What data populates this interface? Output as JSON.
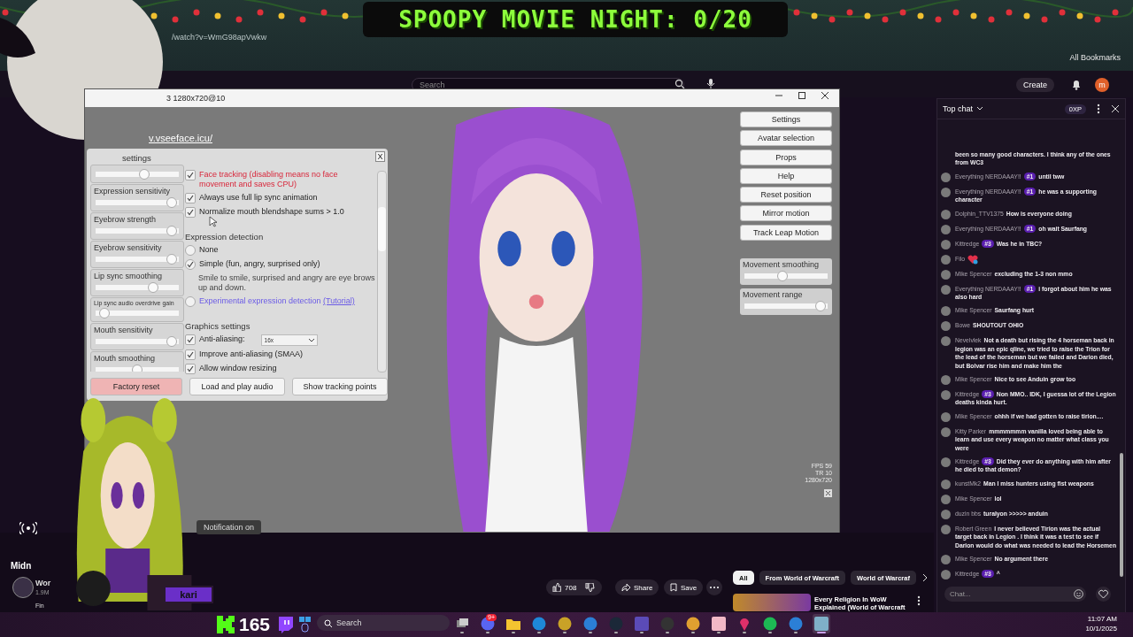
{
  "banner": {
    "title": "SPOOPY MOVIE NIGHT: 0/20"
  },
  "browser": {
    "url": "/watch?v=WmG98apVwkw",
    "bookmarks": "All Bookmarks"
  },
  "youtube": {
    "search_placeholder": "Search",
    "create": "Create",
    "account_initial": "m",
    "notification": "Notification on",
    "channel_title": "Midn",
    "channel_name": "Wor",
    "subscribers": "1.9M",
    "footer_text": "Fin",
    "likes": "708",
    "actions": [
      "Share",
      "Save"
    ],
    "chips": [
      {
        "label": "All",
        "selected": true
      },
      {
        "label": "From World of Warcraft",
        "selected": false
      },
      {
        "label": "World of Warcraf",
        "selected": false
      }
    ],
    "video_title": [
      "Every Religion In WoW",
      "Explained (World of Warcraft"
    ]
  },
  "vseeface": {
    "title": "3 1280x720@10",
    "url": "v.vseeface.icu/",
    "settings": {
      "title": "settings",
      "close": "X",
      "sliders": [
        {
          "level": 0.6
        },
        {
          "label": "Expression sensitivity",
          "level": 0.97
        },
        {
          "label": "Eyebrow strength",
          "level": 0.97
        },
        {
          "label": "Eyebrow sensitivity",
          "level": 0.97
        },
        {
          "label": "Lip  sync smoothing",
          "level": 0.72
        },
        {
          "label": "Lip sync audio overdrive gain",
          "level": 0.05,
          "small": true
        },
        {
          "label": "Mouth sensitivity",
          "level": 0.97
        },
        {
          "label": "Mouth smoothing",
          "level": 0.5
        }
      ],
      "options": [
        {
          "kind": "checkbox",
          "label": "Face tracking (disabling means no face movement and saves CPU)",
          "checked": true,
          "warning": true
        },
        {
          "kind": "checkbox",
          "label": "Always use full lip sync animation",
          "checked": true
        },
        {
          "kind": "checkbox",
          "label": "Normalize mouth blendshape sums > 1.0",
          "checked": true
        },
        {
          "kind": "heading",
          "label": "Expression detection"
        },
        {
          "kind": "radio",
          "label": "None",
          "checked": false
        },
        {
          "kind": "radio",
          "label": "Simple (fun, angry, surprised only)",
          "checked": true
        },
        {
          "kind": "note",
          "label": "Smile to smile, surprised and angry are eye brows up and down."
        },
        {
          "kind": "link-radio",
          "label": "Experimental expression detection",
          "link": "(Tutorial)",
          "checked": false
        },
        {
          "kind": "heading",
          "label": "Graphics settings"
        },
        {
          "kind": "select",
          "label": "Anti-aliasing:",
          "value": "16x",
          "checked": true
        },
        {
          "kind": "checkbox",
          "label": "Improve anti-aliasing (SMAA)",
          "checked": true
        },
        {
          "kind": "checkbox",
          "label": "Allow window resizing",
          "checked": true
        }
      ],
      "buttons": [
        {
          "label": "Factory reset",
          "kind": "danger"
        },
        {
          "label": "Load and play audio",
          "kind": "normal"
        },
        {
          "label": "Show tracking points",
          "kind": "normal"
        }
      ]
    },
    "side_buttons": [
      "Settings",
      "Avatar selection",
      "Props",
      "Help",
      "Reset position",
      "Mirror motion",
      "Track Leap Motion"
    ],
    "side_sliders": [
      {
        "label": "Movement smoothing",
        "level": 0.45
      },
      {
        "label": "Movement range",
        "level": 0.98
      }
    ],
    "stats": [
      "FPS 59",
      "TR 10",
      "1280x720"
    ]
  },
  "overlay": {
    "nametag": "kari"
  },
  "chat": {
    "title": "Top chat",
    "xp": "0XP",
    "placeholder": "Chat...",
    "messages": [
      {
        "text": "been so many good characters. I think any of the ones from WC3"
      },
      {
        "author": "Everything NERDAAAY!!",
        "badge": "#1",
        "text": "until tww"
      },
      {
        "author": "Everything NERDAAAY!!",
        "badge": "#1",
        "text": "he was a supporting character"
      },
      {
        "author": "Dolphin_TTV1375",
        "text": "How is everyone doing"
      },
      {
        "author": "Everything NERDAAAY!!",
        "badge": "#1",
        "text": "oh wait Saurfang"
      },
      {
        "author": "Kittredge",
        "badge": "#3",
        "text": "Was he in TBC?"
      },
      {
        "author": "Filo",
        "kind": "emote"
      },
      {
        "author": "Mike Spencer",
        "text": "excluding the 1-3 non mmo"
      },
      {
        "author": "Everything NERDAAAY!!",
        "badge": "#1",
        "text": "i forgot about him he was also hard"
      },
      {
        "author": "Mike Spencer",
        "text": "Saurfang hurt"
      },
      {
        "author": "Bowe",
        "text": "SHOUTOUT OHIO"
      },
      {
        "author": "Nevelvlek",
        "text": "Not a death but rising the 4 horseman back in legion was an epic qline, we tried to raise the Trion for the lead of the horseman but we failed and Darion died, but Bolvar rise him and make him the"
      },
      {
        "author": "Mike Spencer",
        "text": "Nice to see Anduin grow too"
      },
      {
        "author": "Kittredge",
        "badge": "#3",
        "text": "Non MMO.. IDK, I guessa lot of the Legion deaths kinda hurt."
      },
      {
        "author": "Mike Spencer",
        "text": "ohhh if we had gotten to raise tirion...."
      },
      {
        "author": "Kitty Parker",
        "text": "mmmmmmm vanilla loved being able to learn and use every weapon no matter what class you were"
      },
      {
        "author": "Kittredge",
        "badge": "#3",
        "text": "Did they ever do anything with him after he died to that demon?"
      },
      {
        "author": "kunstMk2",
        "text": "Man I miss hunters using fist weapons"
      },
      {
        "author": "Mike Spencer",
        "text": "lol"
      },
      {
        "author": "duzin bbs",
        "text": "turalyon >>>>> anduin"
      },
      {
        "author": "Robert Green",
        "text": "I never believed Tirion was the actual target back in Legion . I think it was a test to see if Darion would do what was needed to lead the Horsemen"
      },
      {
        "author": "Mike Spencer",
        "text": "No argument there"
      },
      {
        "author": "Kittredge",
        "badge": "#3",
        "text": "^"
      }
    ]
  },
  "taskbar": {
    "counter": "165",
    "search_placeholder": "Search",
    "time": "11:07 AM",
    "date": "10/1/2025",
    "apps": [
      {
        "kind": "windows",
        "active": false
      },
      {
        "kind": "round",
        "color": "#5865f2",
        "badge": "9+",
        "active": false
      },
      {
        "kind": "folder",
        "active": false
      },
      {
        "kind": "round",
        "color": "#1e88d8",
        "active": false
      },
      {
        "kind": "round",
        "color": "#c9a227",
        "active": false
      },
      {
        "kind": "round",
        "color": "#2b7fd6",
        "active": false
      },
      {
        "kind": "round",
        "color": "#1b2838",
        "active": false
      },
      {
        "kind": "square",
        "color": "#5b4bb7",
        "active": false
      },
      {
        "kind": "round",
        "color": "#333333",
        "active": false
      },
      {
        "kind": "round",
        "color": "#e0a030",
        "active": false
      },
      {
        "kind": "square",
        "color": "#f2b8c6",
        "active": false
      },
      {
        "kind": "pin",
        "color": "#e0306a",
        "active": false
      },
      {
        "kind": "round",
        "color": "#1db954",
        "active": false
      },
      {
        "kind": "round",
        "color": "#2b7fd6",
        "active": false
      },
      {
        "kind": "square",
        "color": "#7fb0c8",
        "active": true
      }
    ]
  }
}
